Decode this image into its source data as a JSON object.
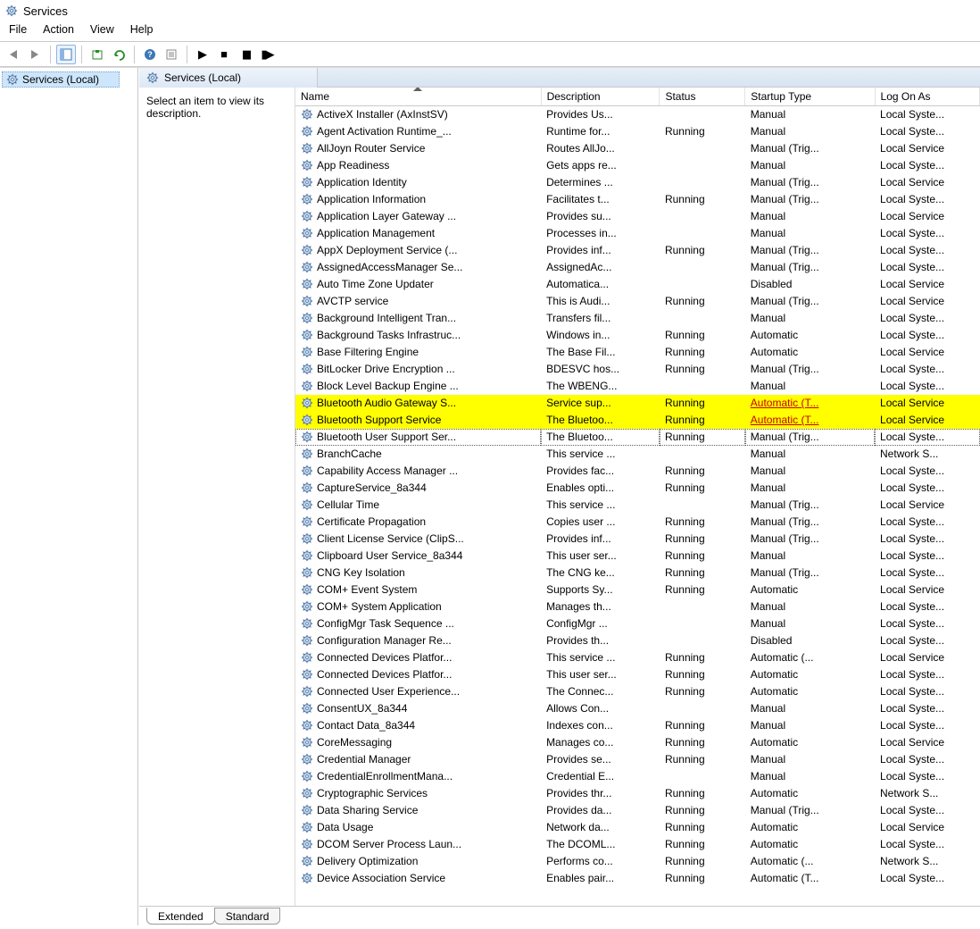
{
  "window": {
    "title": "Services"
  },
  "menu": {
    "file": "File",
    "action": "Action",
    "view": "View",
    "help": "Help"
  },
  "tree": {
    "root": "Services (Local)"
  },
  "content": {
    "header_tab": "Services (Local)",
    "description_prompt": "Select an item to view its description."
  },
  "columns": {
    "name": "Name",
    "description": "Description",
    "status": "Status",
    "startup": "Startup Type",
    "logon": "Log On As"
  },
  "footer_tabs": {
    "extended": "Extended",
    "standard": "Standard"
  },
  "services": [
    {
      "name": "ActiveX Installer (AxInstSV)",
      "desc": "Provides Us...",
      "status": "",
      "startup": "Manual",
      "logon": "Local Syste..."
    },
    {
      "name": "Agent Activation Runtime_...",
      "desc": "Runtime for...",
      "status": "Running",
      "startup": "Manual",
      "logon": "Local Syste..."
    },
    {
      "name": "AllJoyn Router Service",
      "desc": "Routes AllJo...",
      "status": "",
      "startup": "Manual (Trig...",
      "logon": "Local Service"
    },
    {
      "name": "App Readiness",
      "desc": "Gets apps re...",
      "status": "",
      "startup": "Manual",
      "logon": "Local Syste..."
    },
    {
      "name": "Application Identity",
      "desc": "Determines ...",
      "status": "",
      "startup": "Manual (Trig...",
      "logon": "Local Service"
    },
    {
      "name": "Application Information",
      "desc": "Facilitates t...",
      "status": "Running",
      "startup": "Manual (Trig...",
      "logon": "Local Syste..."
    },
    {
      "name": "Application Layer Gateway ...",
      "desc": "Provides su...",
      "status": "",
      "startup": "Manual",
      "logon": "Local Service"
    },
    {
      "name": "Application Management",
      "desc": "Processes in...",
      "status": "",
      "startup": "Manual",
      "logon": "Local Syste..."
    },
    {
      "name": "AppX Deployment Service (...",
      "desc": "Provides inf...",
      "status": "Running",
      "startup": "Manual (Trig...",
      "logon": "Local Syste..."
    },
    {
      "name": "AssignedAccessManager Se...",
      "desc": "AssignedAc...",
      "status": "",
      "startup": "Manual (Trig...",
      "logon": "Local Syste..."
    },
    {
      "name": "Auto Time Zone Updater",
      "desc": "Automatica...",
      "status": "",
      "startup": "Disabled",
      "logon": "Local Service"
    },
    {
      "name": "AVCTP service",
      "desc": "This is Audi...",
      "status": "Running",
      "startup": "Manual (Trig...",
      "logon": "Local Service"
    },
    {
      "name": "Background Intelligent Tran...",
      "desc": "Transfers fil...",
      "status": "",
      "startup": "Manual",
      "logon": "Local Syste..."
    },
    {
      "name": "Background Tasks Infrastruc...",
      "desc": "Windows in...",
      "status": "Running",
      "startup": "Automatic",
      "logon": "Local Syste..."
    },
    {
      "name": "Base Filtering Engine",
      "desc": "The Base Fil...",
      "status": "Running",
      "startup": "Automatic",
      "logon": "Local Service"
    },
    {
      "name": "BitLocker Drive Encryption ...",
      "desc": "BDESVC hos...",
      "status": "Running",
      "startup": "Manual (Trig...",
      "logon": "Local Syste..."
    },
    {
      "name": "Block Level Backup Engine ...",
      "desc": "The WBENG...",
      "status": "",
      "startup": "Manual",
      "logon": "Local Syste..."
    },
    {
      "name": "Bluetooth Audio Gateway S...",
      "desc": "Service sup...",
      "status": "Running",
      "startup": "Automatic (T...",
      "logon": "Local Service",
      "highlight": true
    },
    {
      "name": "Bluetooth Support Service",
      "desc": "The Bluetoo...",
      "status": "Running",
      "startup": "Automatic (T...",
      "logon": "Local Service",
      "highlight": true
    },
    {
      "name": "Bluetooth User Support Ser...",
      "desc": "The Bluetoo...",
      "status": "Running",
      "startup": "Manual (Trig...",
      "logon": "Local Syste...",
      "focus": true
    },
    {
      "name": "BranchCache",
      "desc": "This service ...",
      "status": "",
      "startup": "Manual",
      "logon": "Network S..."
    },
    {
      "name": "Capability Access Manager ...",
      "desc": "Provides fac...",
      "status": "Running",
      "startup": "Manual",
      "logon": "Local Syste..."
    },
    {
      "name": "CaptureService_8a344",
      "desc": "Enables opti...",
      "status": "Running",
      "startup": "Manual",
      "logon": "Local Syste..."
    },
    {
      "name": "Cellular Time",
      "desc": "This service ...",
      "status": "",
      "startup": "Manual (Trig...",
      "logon": "Local Service"
    },
    {
      "name": "Certificate Propagation",
      "desc": "Copies user ...",
      "status": "Running",
      "startup": "Manual (Trig...",
      "logon": "Local Syste..."
    },
    {
      "name": "Client License Service (ClipS...",
      "desc": "Provides inf...",
      "status": "Running",
      "startup": "Manual (Trig...",
      "logon": "Local Syste..."
    },
    {
      "name": "Clipboard User Service_8a344",
      "desc": "This user ser...",
      "status": "Running",
      "startup": "Manual",
      "logon": "Local Syste..."
    },
    {
      "name": "CNG Key Isolation",
      "desc": "The CNG ke...",
      "status": "Running",
      "startup": "Manual (Trig...",
      "logon": "Local Syste..."
    },
    {
      "name": "COM+ Event System",
      "desc": "Supports Sy...",
      "status": "Running",
      "startup": "Automatic",
      "logon": "Local Service"
    },
    {
      "name": "COM+ System Application",
      "desc": "Manages th...",
      "status": "",
      "startup": "Manual",
      "logon": "Local Syste..."
    },
    {
      "name": "ConfigMgr Task Sequence ...",
      "desc": "ConfigMgr ...",
      "status": "",
      "startup": "Manual",
      "logon": "Local Syste..."
    },
    {
      "name": "Configuration Manager Re...",
      "desc": "Provides th...",
      "status": "",
      "startup": "Disabled",
      "logon": "Local Syste..."
    },
    {
      "name": "Connected Devices Platfor...",
      "desc": "This service ...",
      "status": "Running",
      "startup": "Automatic (...",
      "logon": "Local Service"
    },
    {
      "name": "Connected Devices Platfor...",
      "desc": "This user ser...",
      "status": "Running",
      "startup": "Automatic",
      "logon": "Local Syste..."
    },
    {
      "name": "Connected User Experience...",
      "desc": "The Connec...",
      "status": "Running",
      "startup": "Automatic",
      "logon": "Local Syste..."
    },
    {
      "name": "ConsentUX_8a344",
      "desc": "Allows Con...",
      "status": "",
      "startup": "Manual",
      "logon": "Local Syste..."
    },
    {
      "name": "Contact Data_8a344",
      "desc": "Indexes con...",
      "status": "Running",
      "startup": "Manual",
      "logon": "Local Syste..."
    },
    {
      "name": "CoreMessaging",
      "desc": "Manages co...",
      "status": "Running",
      "startup": "Automatic",
      "logon": "Local Service"
    },
    {
      "name": "Credential Manager",
      "desc": "Provides se...",
      "status": "Running",
      "startup": "Manual",
      "logon": "Local Syste..."
    },
    {
      "name": "CredentialEnrollmentMana...",
      "desc": "Credential E...",
      "status": "",
      "startup": "Manual",
      "logon": "Local Syste..."
    },
    {
      "name": "Cryptographic Services",
      "desc": "Provides thr...",
      "status": "Running",
      "startup": "Automatic",
      "logon": "Network S..."
    },
    {
      "name": "Data Sharing Service",
      "desc": "Provides da...",
      "status": "Running",
      "startup": "Manual (Trig...",
      "logon": "Local Syste..."
    },
    {
      "name": "Data Usage",
      "desc": "Network da...",
      "status": "Running",
      "startup": "Automatic",
      "logon": "Local Service"
    },
    {
      "name": "DCOM Server Process Laun...",
      "desc": "The DCOML...",
      "status": "Running",
      "startup": "Automatic",
      "logon": "Local Syste..."
    },
    {
      "name": "Delivery Optimization",
      "desc": "Performs co...",
      "status": "Running",
      "startup": "Automatic (...",
      "logon": "Network S..."
    },
    {
      "name": "Device Association Service",
      "desc": "Enables pair...",
      "status": "Running",
      "startup": "Automatic (T...",
      "logon": "Local Syste..."
    }
  ]
}
